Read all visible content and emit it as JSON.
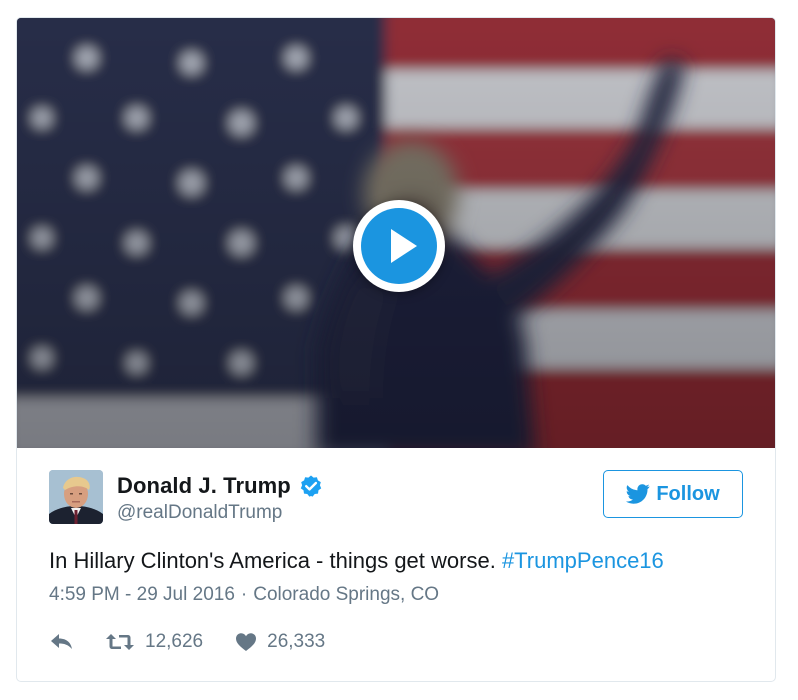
{
  "media": {
    "type": "video",
    "play_icon": "play-icon"
  },
  "user": {
    "name": "Donald J. Trump",
    "handle": "@realDonaldTrump",
    "verified_icon": "verified-badge-icon",
    "avatar_icon": "avatar"
  },
  "follow": {
    "label": "Follow",
    "icon": "twitter-bird-icon"
  },
  "tweet": {
    "text": "In Hillary Clinton's America - things get worse.",
    "hashtag": "#TrumpPence16",
    "time": "4:59 PM - 29 Jul 2016",
    "separator": "·",
    "location": "Colorado Springs, CO"
  },
  "actions": {
    "reply_icon": "reply-icon",
    "retweet_icon": "retweet-icon",
    "retweet_count": "12,626",
    "like_icon": "heart-icon",
    "like_count": "26,333"
  },
  "colors": {
    "accent": "#1b95e0",
    "text": "#14171a",
    "muted": "#657786",
    "border": "#e1e8ed"
  }
}
